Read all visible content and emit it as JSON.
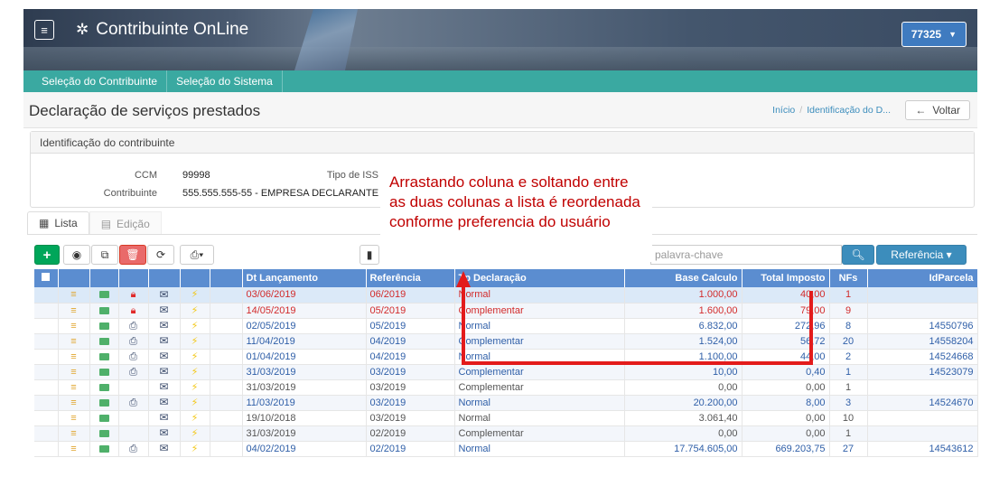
{
  "header": {
    "menu_icon": "hamburger-icon",
    "app_title": "Contribuinte OnLine",
    "brand_icon": "gear-icon",
    "ccm_value": "77325"
  },
  "nav": {
    "items": [
      "Seleção do Contribuinte",
      "Seleção do Sistema"
    ]
  },
  "page": {
    "title": "Declaração de serviços prestados",
    "breadcrumb": [
      "Início",
      "Identificação do D..."
    ],
    "back_label": "Voltar"
  },
  "panel": {
    "title": "Identificação do contribuinte",
    "ccm_label": "CCM",
    "ccm_value": "99998",
    "tipo_iss_label": "Tipo de ISS",
    "contribuinte_label": "Contribuinte",
    "contribuinte_value": "555.555.555-55 - EMPRESA DECLARANTE"
  },
  "tabs": [
    {
      "label": "Lista",
      "icon": "table-icon",
      "active": true
    },
    {
      "label": "Edição",
      "icon": "file-icon",
      "active": false
    }
  ],
  "toolbar": {
    "search_placeholder": "palavra-chave",
    "referencia_label": "Referência",
    "search_icon": "search-icon"
  },
  "callout": {
    "text": "Arrastando coluna e soltando entre as duas colunas a lista é reordenada conforme preferencia do usuário",
    "color": "#c00000"
  },
  "table": {
    "columns": [
      "Dt Lançamento",
      "Referência",
      "Tp Declaração",
      "Base Calculo",
      "Total Imposto",
      "NFs",
      "IdParcela"
    ],
    "rows": [
      {
        "dt": "03/06/2019",
        "ref": "06/2019",
        "tp": "Normal",
        "base": "1.000,00",
        "total": "40,00",
        "nfs": "1",
        "id": "",
        "lock": true,
        "print": false,
        "color": "red",
        "selected": true
      },
      {
        "dt": "14/05/2019",
        "ref": "05/2019",
        "tp": "Complementar",
        "base": "1.600,00",
        "total": "79,00",
        "nfs": "9",
        "id": "",
        "lock": true,
        "print": false,
        "color": "red",
        "selected": false
      },
      {
        "dt": "02/05/2019",
        "ref": "05/2019",
        "tp": "Normal",
        "base": "6.832,00",
        "total": "272,96",
        "nfs": "8",
        "id": "14550796",
        "lock": false,
        "print": true,
        "color": "blue",
        "selected": false
      },
      {
        "dt": "11/04/2019",
        "ref": "04/2019",
        "tp": "Complementar",
        "base": "1.524,00",
        "total": "56,72",
        "nfs": "20",
        "id": "14558204",
        "lock": false,
        "print": true,
        "color": "blue",
        "selected": false
      },
      {
        "dt": "01/04/2019",
        "ref": "04/2019",
        "tp": "Normal",
        "base": "1.100,00",
        "total": "44,00",
        "nfs": "2",
        "id": "14524668",
        "lock": false,
        "print": true,
        "color": "blue",
        "selected": false
      },
      {
        "dt": "31/03/2019",
        "ref": "03/2019",
        "tp": "Complementar",
        "base": "10,00",
        "total": "0,40",
        "nfs": "1",
        "id": "14523079",
        "lock": false,
        "print": true,
        "color": "blue",
        "selected": false
      },
      {
        "dt": "31/03/2019",
        "ref": "03/2019",
        "tp": "Complementar",
        "base": "0,00",
        "total": "0,00",
        "nfs": "1",
        "id": "",
        "lock": false,
        "print": false,
        "color": "dark",
        "selected": false
      },
      {
        "dt": "11/03/2019",
        "ref": "03/2019",
        "tp": "Normal",
        "base": "20.200,00",
        "total": "8,00",
        "nfs": "3",
        "id": "14524670",
        "lock": false,
        "print": true,
        "color": "blue",
        "selected": false
      },
      {
        "dt": "19/10/2018",
        "ref": "03/2019",
        "tp": "Normal",
        "base": "3.061,40",
        "total": "0,00",
        "nfs": "10",
        "id": "",
        "lock": false,
        "print": false,
        "color": "dark",
        "selected": false
      },
      {
        "dt": "31/03/2019",
        "ref": "02/2019",
        "tp": "Complementar",
        "base": "0,00",
        "total": "0,00",
        "nfs": "1",
        "id": "",
        "lock": false,
        "print": false,
        "color": "dark",
        "selected": false
      },
      {
        "dt": "04/02/2019",
        "ref": "02/2019",
        "tp": "Normal",
        "base": "17.754.605,00",
        "total": "669.203,75",
        "nfs": "27",
        "id": "14543612",
        "lock": false,
        "print": true,
        "color": "blue",
        "selected": false
      }
    ]
  }
}
